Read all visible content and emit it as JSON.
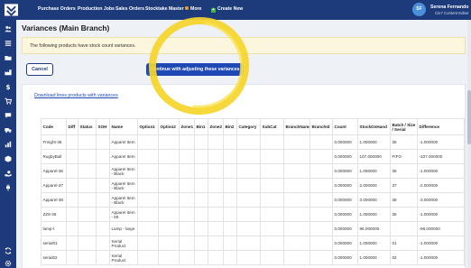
{
  "topbar": {
    "nav": [
      "Purchase Orders",
      "Production Jobs",
      "Sales Orders",
      "Stocktake Master",
      "More",
      "Create New"
    ],
    "user_initials": "SF",
    "user_name": "Serena Fernando",
    "user_role": "Cin7 Content Editor"
  },
  "sidebar": {
    "icons": [
      "people-icon",
      "list-icon",
      "folder-icon",
      "factory-icon",
      "dollar-icon",
      "cart-icon",
      "chat-icon",
      "truck-icon",
      "report-icon",
      "box-icon",
      "hand-icon",
      "plug-icon",
      "sync-icon",
      "gear-icon"
    ]
  },
  "page": {
    "title": "Variances (Main Branch)",
    "notice": "The following products have stock count variances.",
    "cancel_label": "Cancel",
    "continue_label": "Continue with adjusting these variances",
    "download_link": "Download lines products with variances"
  },
  "table": {
    "headers": [
      "Code",
      "Diff",
      "Status",
      "SOH",
      "Name",
      "Option1",
      "Option2",
      "Zone1",
      "Bin1",
      "Zone2",
      "Bin2",
      "Category",
      "SubCat",
      "BranchName",
      "BranchId",
      "Count",
      "StockOnHand",
      "Batch / Size / Serial",
      "Difference"
    ],
    "rows": [
      [
        "Freight-36",
        "",
        "",
        "",
        "Apparel Item",
        "",
        "",
        "",
        "",
        "",
        "",
        "",
        "",
        "",
        "",
        "0.000000",
        "1.000000",
        "36",
        "-1.000000"
      ],
      [
        "RugbyBall",
        "",
        "",
        "",
        "Apparel Item",
        "",
        "",
        "",
        "",
        "",
        "",
        "",
        "",
        "",
        "",
        "0.000000",
        "107.000000",
        "FIFO",
        "-107.000000"
      ],
      [
        "Apparel-36",
        "",
        "",
        "",
        "Apparel Item - Black",
        "",
        "",
        "",
        "",
        "",
        "",
        "",
        "",
        "",
        "",
        "0.000000",
        "1.000000",
        "36",
        "-1.000000"
      ],
      [
        "Apparel-37",
        "",
        "",
        "",
        "Apparel Item - Black",
        "",
        "",
        "",
        "",
        "",
        "",
        "",
        "",
        "",
        "",
        "0.000000",
        "2.000000",
        "37",
        "-2.000000"
      ],
      [
        "Apparel-38",
        "",
        "",
        "",
        "Apparel Item - Black",
        "",
        "",
        "",
        "",
        "",
        "",
        "",
        "",
        "",
        "",
        "0.000000",
        "3.000000",
        "38",
        "-3.000000"
      ],
      [
        "ZZ8-36",
        "",
        "",
        "",
        "Apparel Item - 55",
        "",
        "",
        "",
        "",
        "",
        "",
        "",
        "",
        "",
        "",
        "0.000000",
        "1.000000",
        "36",
        "-1.000000"
      ],
      [
        "lamp-l",
        "",
        "",
        "",
        "Lamp - large",
        "",
        "",
        "",
        "",
        "",
        "",
        "",
        "",
        "",
        "",
        "0.000000",
        "96.000000",
        "",
        "-96.000000"
      ],
      [
        "serial01",
        "",
        "",
        "",
        "Serial Product",
        "",
        "",
        "",
        "",
        "",
        "",
        "",
        "",
        "",
        "",
        "0.000000",
        "1.000000",
        "01",
        "-1.000000"
      ],
      [
        "serial02",
        "",
        "",
        "",
        "Serial Product",
        "",
        "",
        "",
        "",
        "",
        "",
        "",
        "",
        "",
        "",
        "0.000000",
        "1.000000",
        "02",
        "-1.000000"
      ]
    ]
  },
  "colors": {
    "nav_bg": "#1d3b7a",
    "primary_button": "#1f49b5",
    "notice_bg": "#fbf6dd",
    "highlight": "#f6d52a"
  }
}
